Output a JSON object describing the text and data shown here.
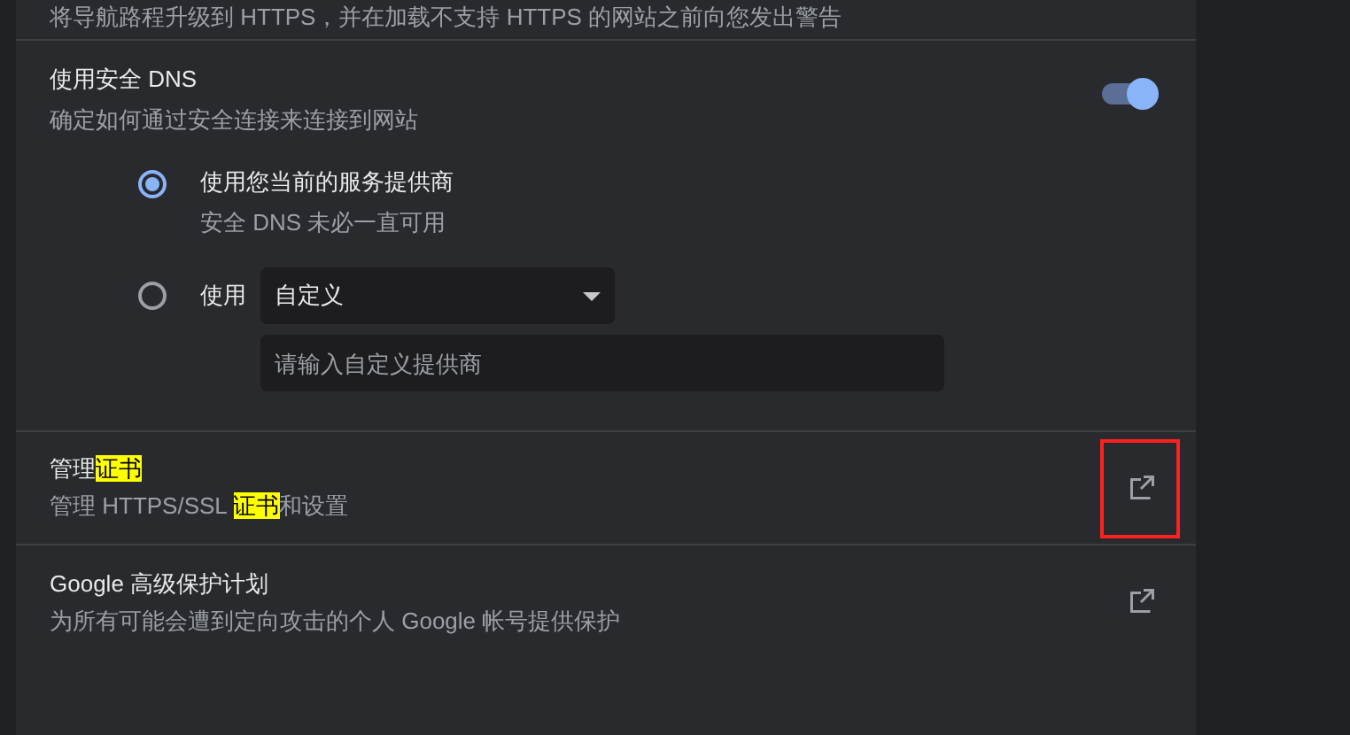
{
  "cut_text": "将导航路程升级到 HTTPS，并在加载不支持 HTTPS 的网站之前向您发出警告",
  "secure_dns": {
    "title": "使用安全 DNS",
    "subtitle": "确定如何通过安全连接来连接到网站",
    "on": true,
    "options": [
      {
        "kind": "provider",
        "label": "使用您当前的服务提供商",
        "sublabel": "安全 DNS 未必一直可用",
        "selected": true
      },
      {
        "kind": "custom",
        "label": "使用",
        "selected": false,
        "dropdown": "自定义",
        "placeholder": "请输入自定义提供商"
      }
    ]
  },
  "links": [
    {
      "title": [
        {
          "text": "管理",
          "highlighted": false
        },
        {
          "text": "证书",
          "highlighted": true
        }
      ],
      "subtitle": [
        {
          "text": "管理 HTTPS/SSL ",
          "highlighted": false
        },
        {
          "text": "证书",
          "highlighted": true
        },
        {
          "text": "和设置",
          "highlighted": false
        }
      ],
      "outlined": true
    },
    {
      "title": [
        {
          "text": "Google 高级保护计划",
          "highlighted": false
        }
      ],
      "subtitle": [
        {
          "text": "为所有可能会遭到定向攻击的个人 Google 帐号提供保护",
          "highlighted": false
        }
      ],
      "outlined": false
    }
  ]
}
